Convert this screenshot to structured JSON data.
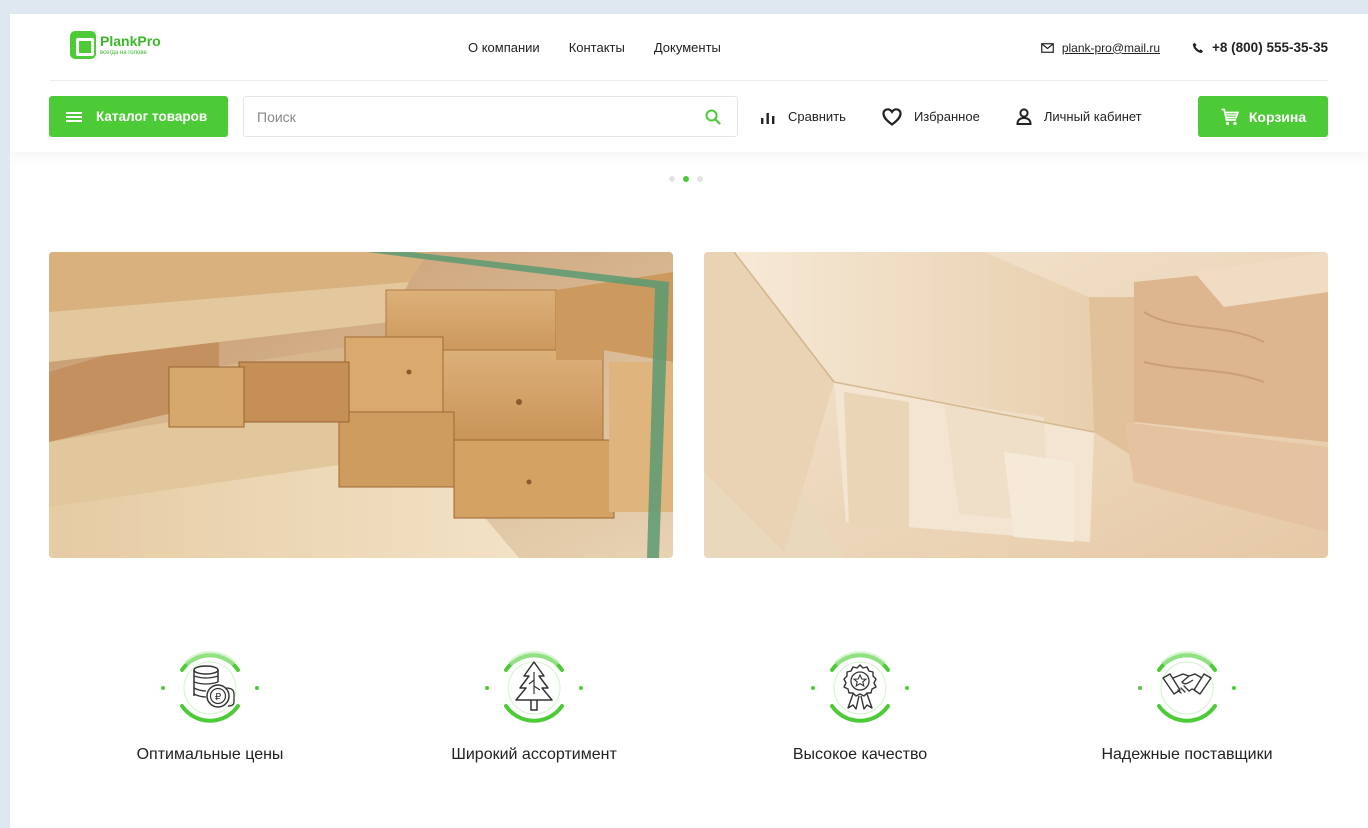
{
  "logo": {
    "name": "PlankPro",
    "tagline": "всегда на голове"
  },
  "topnav": [
    "О компании",
    "Контакты",
    "Документы"
  ],
  "contacts": {
    "email": "plank-pro@mail.ru",
    "phone": "+8 (800) 555-35-35"
  },
  "catalog": {
    "label": "Каталог товаров"
  },
  "search": {
    "placeholder": "Поиск",
    "value": ""
  },
  "actions": {
    "compare": "Сравнить",
    "favorites": "Избранное",
    "account": "Личный кабинет"
  },
  "cart": {
    "label": "Корзина"
  },
  "slider": {
    "count": 3,
    "active": 2
  },
  "colors": {
    "accent": "#4ccb36",
    "text": "#222222",
    "bg": "#dfe7f0"
  },
  "features": [
    {
      "icon": "coins-icon",
      "title": "Оптимальные цены"
    },
    {
      "icon": "tree-icon",
      "title": "Широкий ассортимент"
    },
    {
      "icon": "award-icon",
      "title": "Высокое качество"
    },
    {
      "icon": "handshake-icon",
      "title": "Надежные поставщики"
    }
  ]
}
